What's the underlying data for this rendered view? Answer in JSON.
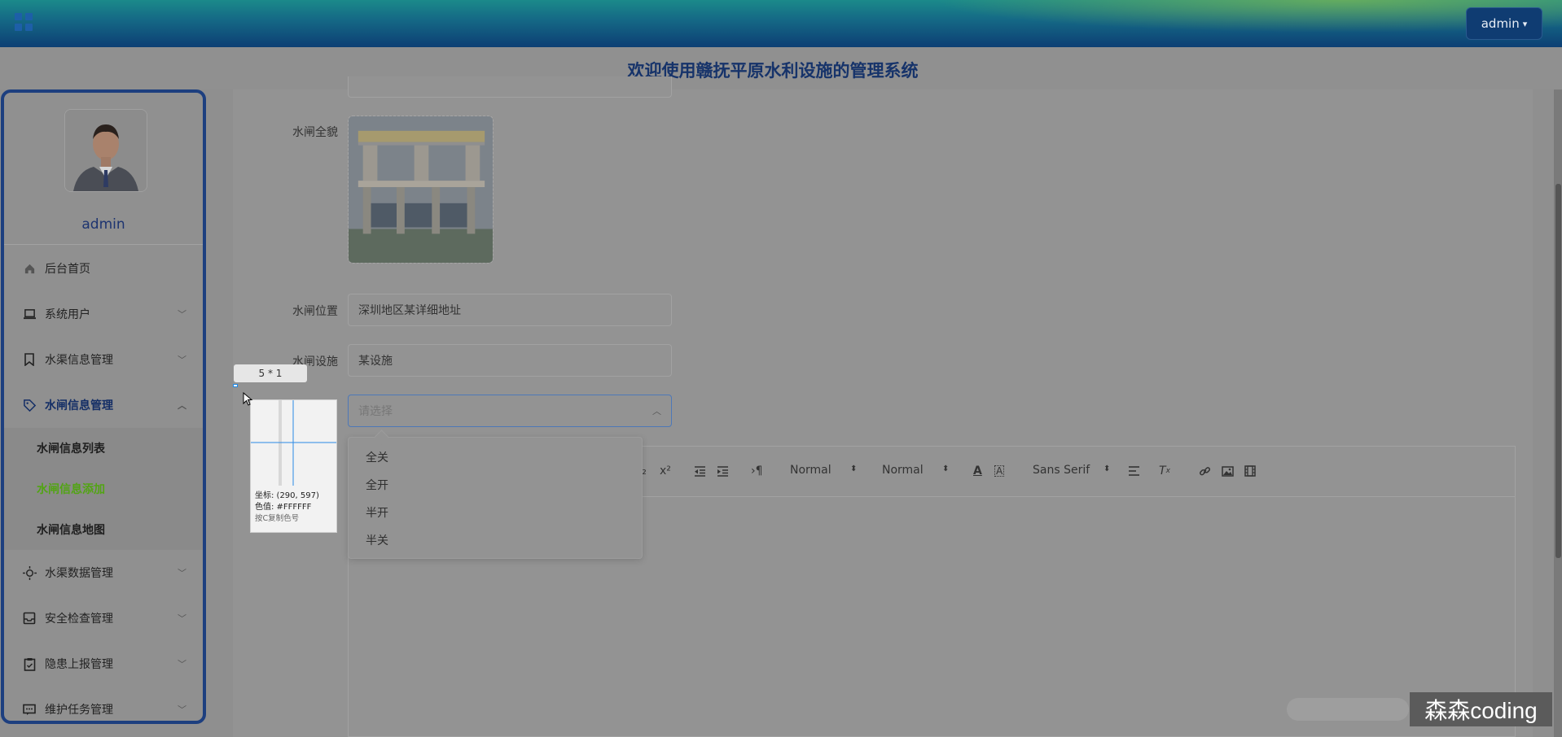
{
  "header": {
    "user_button_label": "admin",
    "system_title": "欢迎使用赣抚平原水利设施的管理系统"
  },
  "sidebar": {
    "username": "admin",
    "items": [
      {
        "label": "后台首页",
        "icon": "home-icon"
      },
      {
        "label": "系统用户",
        "icon": "laptop-icon"
      },
      {
        "label": "水渠信息管理",
        "icon": "bookmark-icon"
      },
      {
        "label": "水闸信息管理",
        "icon": "tag-icon"
      },
      {
        "label": "水渠数据管理",
        "icon": "sun-icon"
      },
      {
        "label": "安全检查管理",
        "icon": "inbox-icon"
      },
      {
        "label": "隐患上报管理",
        "icon": "clipboard-icon"
      },
      {
        "label": "维护任务管理",
        "icon": "message-icon"
      }
    ],
    "subitems": [
      {
        "label": "水闸信息列表"
      },
      {
        "label": "水闸信息添加"
      },
      {
        "label": "水闸信息地图"
      }
    ]
  },
  "form": {
    "image_label": "水闸全貌",
    "location_label": "水闸位置",
    "location_value": "深圳地区某详细地址",
    "facility_label": "水闸设施",
    "facility_value": "某设施",
    "status_placeholder": "请选择"
  },
  "dropdown": {
    "options": [
      "全关",
      "全开",
      "半开",
      "半关"
    ]
  },
  "editor": {
    "header_select": "Normal",
    "size_select": "Normal",
    "font_select": "Sans Serif"
  },
  "color_picker": {
    "size_label": "5 * 1",
    "coord_label": "坐标: (290, 597)",
    "color_label": "色值: #FFFFFF",
    "hint": "按C复制色号"
  },
  "watermark": {
    "text": "森森coding"
  }
}
